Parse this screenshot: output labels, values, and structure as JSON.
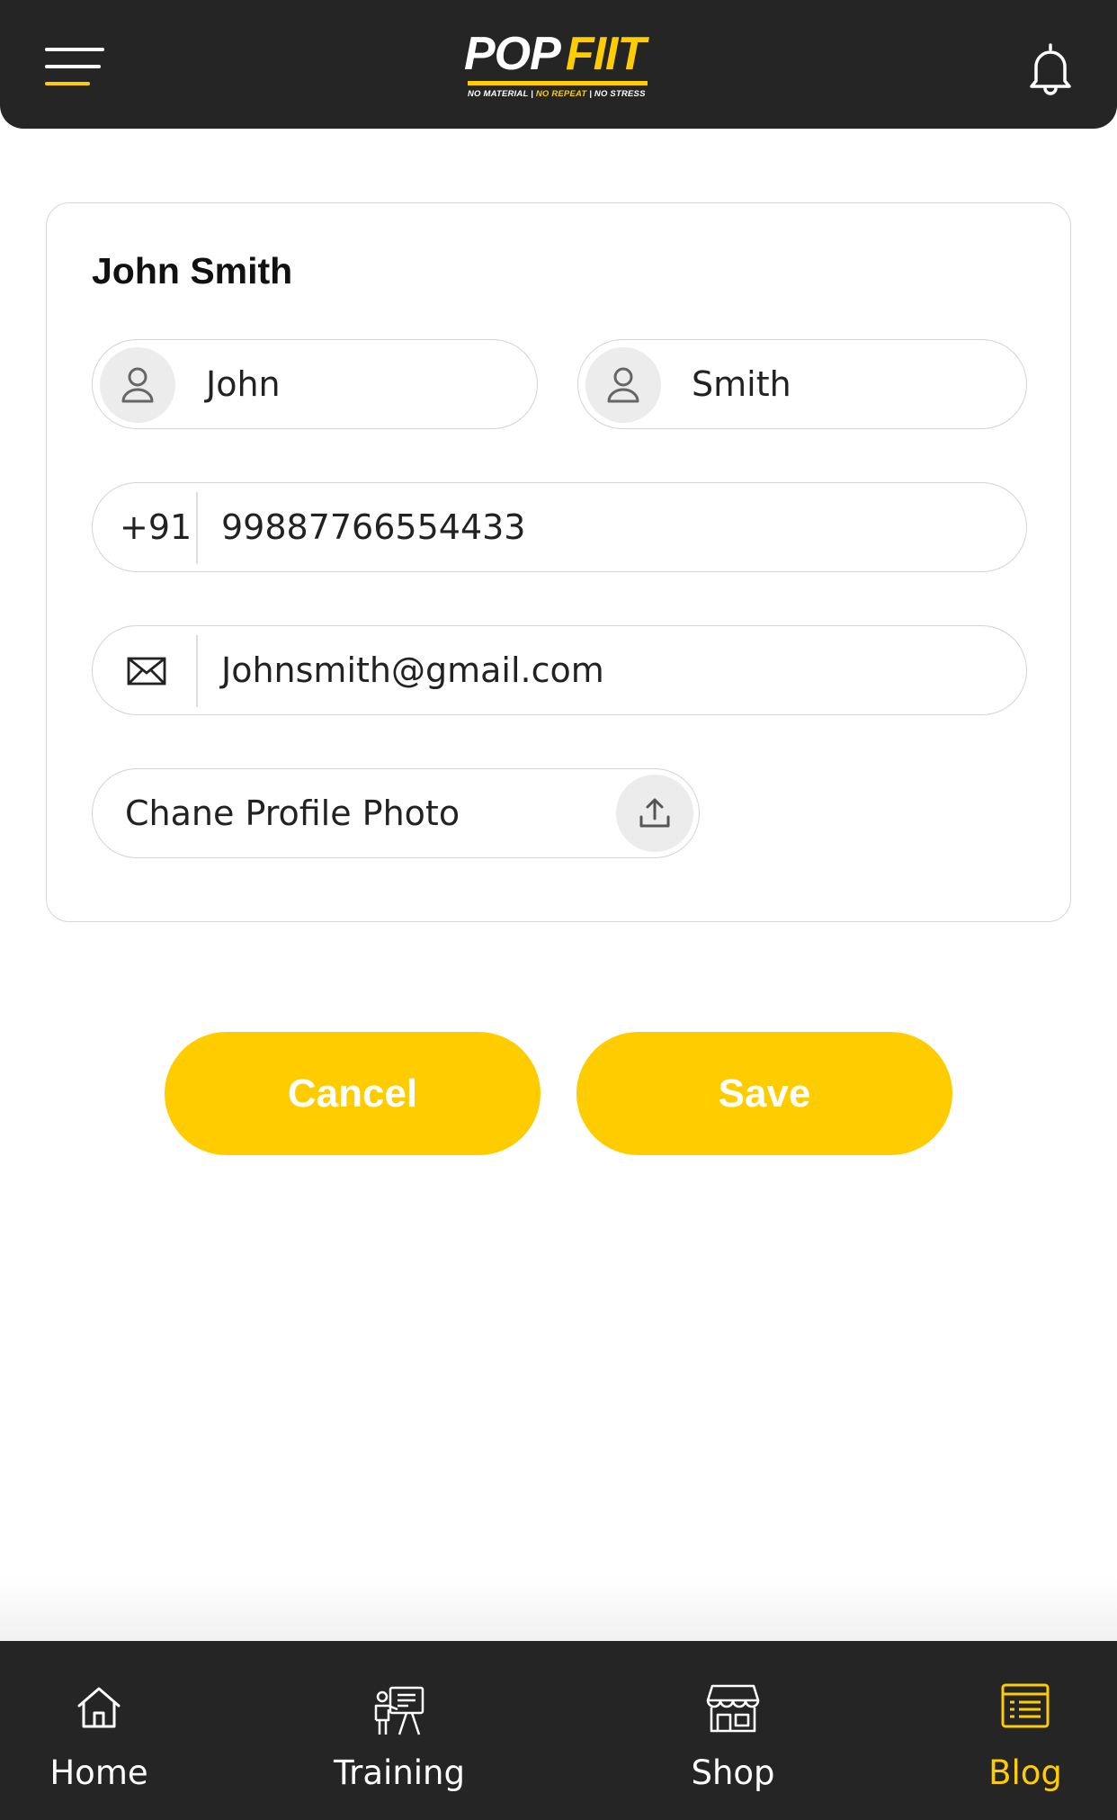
{
  "header": {
    "logo": {
      "word1": "POP",
      "word2": "FIIT",
      "tagline": [
        "NO MATERIAL",
        "NO REPEAT",
        "NO STRESS"
      ]
    },
    "menu_icon": "hamburger-menu-icon",
    "notification_icon": "bell-icon"
  },
  "profile": {
    "title": "John Smith",
    "first_name": "John",
    "last_name": "Smith",
    "country_code": "+91",
    "phone": "99887766554433",
    "email": "Johnsmith@gmail.com",
    "photo_label": "Chane Profile Photo"
  },
  "actions": {
    "cancel": "Cancel",
    "save": "Save"
  },
  "nav": [
    {
      "label": "Home",
      "icon": "home-icon",
      "active": false
    },
    {
      "label": "Training",
      "icon": "training-icon",
      "active": false
    },
    {
      "label": "Shop",
      "icon": "shop-icon",
      "active": false
    },
    {
      "label": "Blog",
      "icon": "blog-icon",
      "active": true
    }
  ],
  "colors": {
    "accent": "#ffcc00",
    "dark": "#252525"
  }
}
